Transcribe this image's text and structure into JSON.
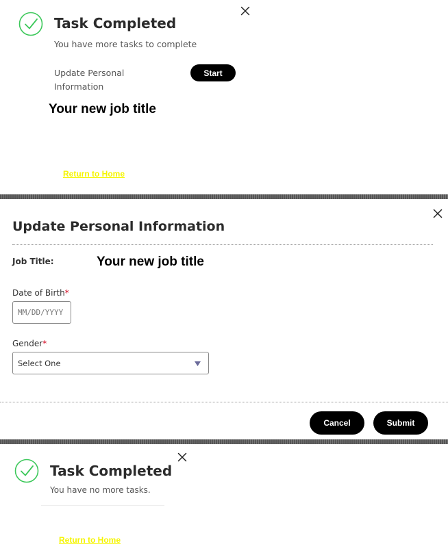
{
  "section1": {
    "title": "Task Completed",
    "subtitle": "You have more tasks to complete",
    "task_label_line1": "Update Personal",
    "task_label_line2": "Information",
    "start_label": "Start",
    "job_title_text": "Your new job title",
    "return_link": "Return to Home"
  },
  "section2": {
    "title": "Update Personal Information",
    "job_title_label": "Job Title:",
    "job_title_value": "Your new job title",
    "dob_label": "Date of Birth",
    "dob_placeholder": "MM/DD/YYYY",
    "gender_label": "Gender",
    "gender_selected": "Select One",
    "required_marker": "*",
    "cancel_label": "Cancel",
    "submit_label": "Submit"
  },
  "section3": {
    "title": "Task Completed",
    "subtitle": "You have no more tasks.",
    "return_link": "Return to Home"
  },
  "colors": {
    "check_green": "#3cc85a",
    "link_yellow": "#f5f500",
    "button_black": "#000000",
    "required_red": "#d0021b"
  },
  "icons": [
    "check-circle-icon",
    "close-icon",
    "chevron-down-icon"
  ]
}
